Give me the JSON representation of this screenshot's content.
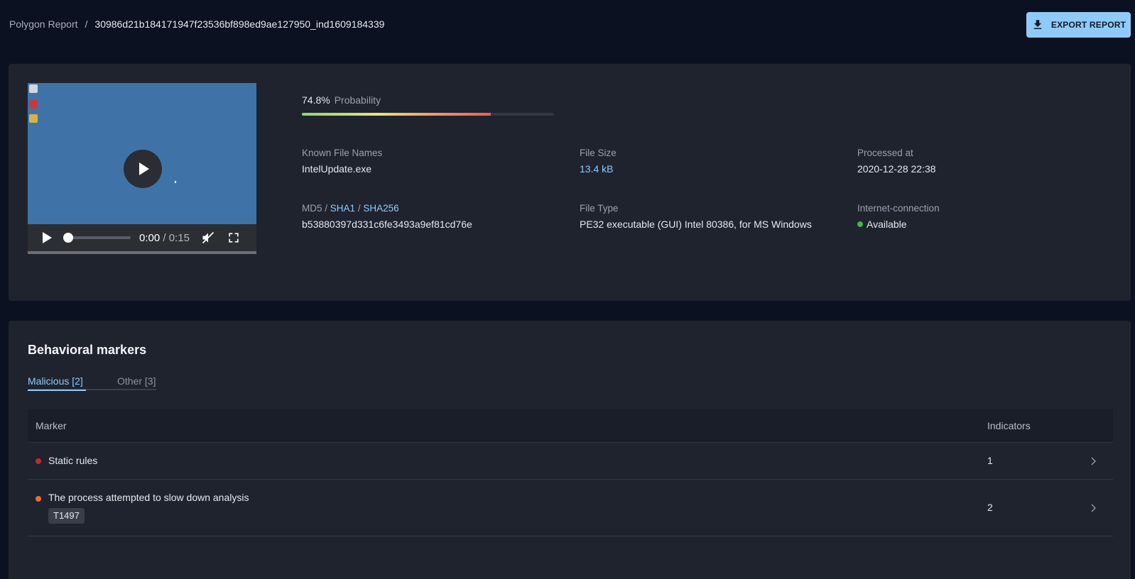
{
  "breadcrumb": {
    "root": "Polygon Report",
    "separator": "/",
    "current": "30986d21b184171947f23536bf898ed9ae127950_ind1609184339"
  },
  "export_button": {
    "label": "EXPORT REPORT",
    "icon": "download-icon"
  },
  "video": {
    "current_time": "0:00",
    "separator": "/",
    "total_time": "0:15",
    "progress": 0.0,
    "muted": true
  },
  "probability": {
    "value_text": "74.8%",
    "label": "Probability",
    "value": 0.748
  },
  "file_info": {
    "known_file_names": {
      "label": "Known File Names",
      "value": "IntelUpdate.exe"
    },
    "file_size": {
      "label": "File Size",
      "value": "13.4 kB"
    },
    "processed_at": {
      "label": "Processed at",
      "value": "2020-12-28 22:38"
    },
    "hashes": {
      "md5_label": "MD5",
      "sep": " / ",
      "sha1_label": "SHA1",
      "sha256_label": "SHA256",
      "value": "b53880397d331c6fe3493a9ef81cd76e"
    },
    "file_type": {
      "label": "File Type",
      "value": "PE32 executable (GUI) Intel 80386, for MS Windows"
    },
    "internet_connection": {
      "label": "Internet-connection",
      "value": "Available",
      "status_color": "#4caf50"
    }
  },
  "behavioral": {
    "title": "Behavioral markers",
    "tabs": [
      {
        "label": "Malicious [2]",
        "active": true
      },
      {
        "label": "Other [3]",
        "active": false
      }
    ],
    "columns": {
      "marker": "Marker",
      "indicators": "Indicators"
    },
    "rows": [
      {
        "name": "Static rules",
        "severity_color": "#c62828",
        "indicators": "1",
        "tag": ""
      },
      {
        "name": "The process attempted to slow down analysis",
        "severity_color": "#ef6c2b",
        "indicators": "2",
        "tag": "T1497"
      }
    ]
  },
  "colors": {
    "accent": "#90caf9",
    "background": "#0b1120",
    "card": "#1f232e"
  }
}
